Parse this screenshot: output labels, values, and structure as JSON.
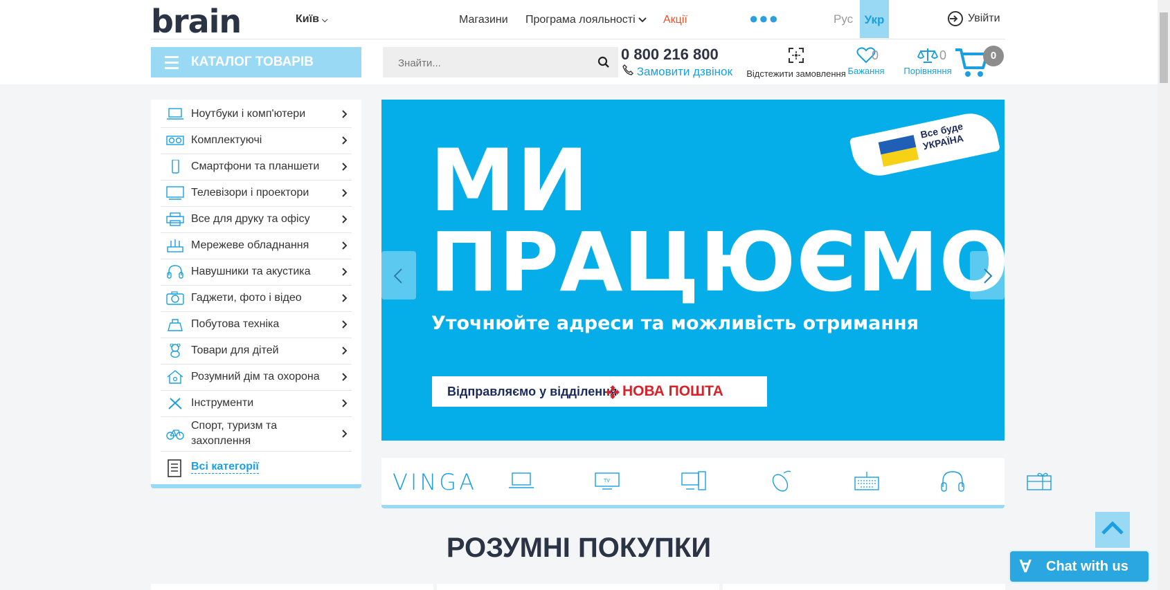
{
  "header": {
    "logo": "brain",
    "city": "Київ",
    "nav": [
      "Магазини",
      "Програма лояльності",
      "Акції"
    ],
    "lang": {
      "ru": "Рус",
      "uk": "Укр"
    },
    "login": "Увійти",
    "catalog_label": "КАТАЛОГ ТОВАРІВ",
    "search_placeholder": "Знайти...",
    "phone": "0 800 216 800",
    "callback": "Замовити дзвінок",
    "track_label": "Відстежити замовлення",
    "wishlist_label": "Бажання",
    "wishlist_count": "0",
    "compare_label": "Порівняння",
    "compare_count": "0",
    "cart_count": "0"
  },
  "sidebar": {
    "items": [
      {
        "label": "Ноутбуки і комп'ютери",
        "icon": "laptop-icon"
      },
      {
        "label": "Комплектуючі",
        "icon": "gpu-icon"
      },
      {
        "label": "Смартфони та планшети",
        "icon": "smartphone-icon"
      },
      {
        "label": "Телевізори і проектори",
        "icon": "tv-icon"
      },
      {
        "label": "Все для друку та офісу",
        "icon": "printer-icon"
      },
      {
        "label": "Мережеве обладнання",
        "icon": "router-icon"
      },
      {
        "label": "Навушники та акустика",
        "icon": "headphones-icon"
      },
      {
        "label": "Гаджети, фото і відео",
        "icon": "camera-icon"
      },
      {
        "label": "Побутова техніка",
        "icon": "appliance-icon"
      },
      {
        "label": "Товари для дітей",
        "icon": "teddy-bear-icon"
      },
      {
        "label": "Розумний дім та охорона",
        "icon": "smart-home-icon"
      },
      {
        "label": "Інструменти",
        "icon": "tools-icon"
      },
      {
        "label": "Спорт, туризм та захоплення",
        "icon": "bicycle-icon"
      }
    ],
    "all_label": "Всі категорії"
  },
  "banner": {
    "title_line1": "МИ",
    "title_line2": "ПРАЦЮЄМО",
    "subtitle": "Уточнюйте адреси та можливість отримання",
    "np_text": "Відправляємо у відділення",
    "np_brand": "НОВА ПОШТА",
    "badge_text": "Все буде УКРАЇНА"
  },
  "brands": {
    "vinga": "VINGA",
    "icons": [
      "laptop-icon",
      "tv-icon",
      "desktop-pc-icon",
      "mouse-icon",
      "keyboard-icon",
      "headphones-icon",
      "gift-card-icon"
    ]
  },
  "smart_title": "РОЗУМНІ ПОКУПКИ",
  "chat_label": "Chat with us"
}
